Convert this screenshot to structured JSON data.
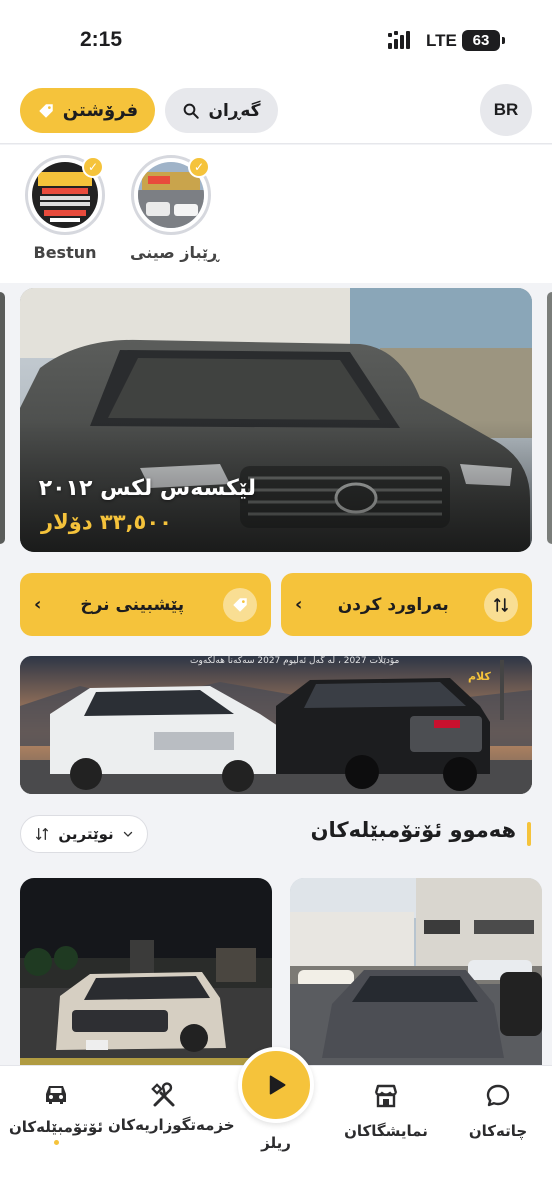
{
  "status_bar": {
    "time": "2:15",
    "network": "LTE",
    "battery": "63"
  },
  "header": {
    "sell_label": "فرۆشتن",
    "search_label": "گەڕان",
    "avatar_initials": "BR"
  },
  "stories": [
    {
      "name": "Bestun"
    },
    {
      "name": "ڕێباز صینی"
    }
  ],
  "hero": {
    "title": "لێکسەس لکس ٢٠١٢",
    "price": "٣٣,٥٠٠ دۆلار"
  },
  "actions": {
    "compare_label": "بەراورد کردن",
    "predict_label": "پێشبینی نرخ"
  },
  "banner": {
    "caption": "مۆدێلات 2027 ، لە گەڵ ئەلیوم 2027 سەکەنا هەڵکەوت",
    "brand": "کلام"
  },
  "listing": {
    "title": "هەموو ئۆتۆمبێلەکان",
    "sort_label": "نوێترین"
  },
  "bottom_nav": {
    "cars": "ئۆتۆمبێلەکان",
    "services": "خزمەتگوزاریەکان",
    "reels": "ریلز",
    "showrooms": "نمایشگاکان",
    "chats": "چاتەکان"
  },
  "colors": {
    "accent": "#f5c33b",
    "background": "#f2f3f6"
  }
}
